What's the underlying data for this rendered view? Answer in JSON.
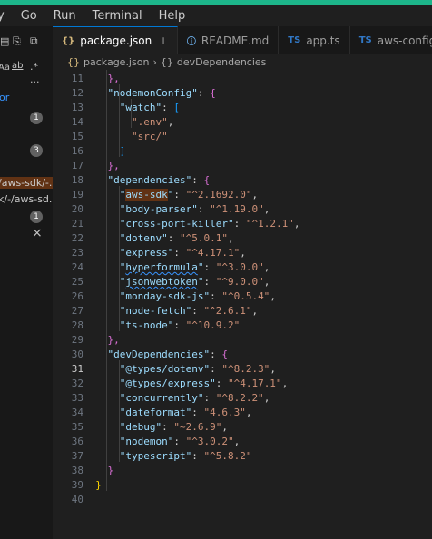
{
  "menu": {
    "items": [
      "Go",
      "Run",
      "Terminal",
      "Help"
    ],
    "partial_first": "y"
  },
  "sidebar": {
    "search_opts": [
      "Aa",
      "ab",
      ".*"
    ],
    "more": "···",
    "label_or": "or",
    "badges": [
      "1",
      "3",
      "1"
    ],
    "files": [
      "/aws-sdk/-...",
      "k/-/aws-sd..."
    ],
    "close": "×"
  },
  "tabs": [
    {
      "icon": "{}",
      "label": "package.json",
      "pinned": true,
      "active": true
    },
    {
      "icon": "ⓘ",
      "label": "README.md"
    },
    {
      "icon": "TS",
      "label": "app.ts"
    },
    {
      "icon": "TS",
      "label": "aws-config.ts"
    }
  ],
  "breadcrumb": {
    "file": "package.json",
    "symbol": "devDependencies"
  },
  "editor": {
    "current_line": 31,
    "lines": [
      {
        "n": "11",
        "t": [
          [
            "b2",
            "    },"
          ]
        ]
      },
      {
        "n": "12",
        "t": [
          [
            "k",
            "    \"nodemonConfig\""
          ],
          [
            "p",
            ": "
          ],
          [
            "b2",
            "{"
          ]
        ]
      },
      {
        "n": "13",
        "t": [
          [
            "k",
            "      \"watch\""
          ],
          [
            "p",
            ": "
          ],
          [
            "b3",
            "["
          ]
        ]
      },
      {
        "n": "14",
        "t": [
          [
            "s",
            "        \".env\""
          ],
          [
            "p",
            ","
          ]
        ]
      },
      {
        "n": "15",
        "t": [
          [
            "s",
            "        \"src/\""
          ]
        ]
      },
      {
        "n": "16",
        "t": [
          [
            "b3",
            "      ]"
          ]
        ]
      },
      {
        "n": "17",
        "t": [
          [
            "b2",
            "    },"
          ]
        ]
      },
      {
        "n": "18",
        "t": [
          [
            "k",
            "    \"dependencies\""
          ],
          [
            "p",
            ": "
          ],
          [
            "b2",
            "{"
          ]
        ]
      },
      {
        "n": "19",
        "t": [
          [
            "k",
            "      \""
          ],
          [
            "khl",
            "aws-sdk"
          ],
          [
            "k",
            "\""
          ],
          [
            "p",
            ": "
          ],
          [
            "s",
            "\"^2.1692.0\""
          ],
          [
            "p",
            ","
          ]
        ]
      },
      {
        "n": "20",
        "t": [
          [
            "k",
            "      \"body-parser\""
          ],
          [
            "p",
            ": "
          ],
          [
            "s",
            "\"^1.19.0\""
          ],
          [
            "p",
            ","
          ]
        ]
      },
      {
        "n": "21",
        "t": [
          [
            "k",
            "      \"cross-port-killer\""
          ],
          [
            "p",
            ": "
          ],
          [
            "s",
            "\"^1.2.1\""
          ],
          [
            "p",
            ","
          ]
        ]
      },
      {
        "n": "22",
        "t": [
          [
            "k",
            "      \"dotenv\""
          ],
          [
            "p",
            ": "
          ],
          [
            "s",
            "\"^5.0.1\""
          ],
          [
            "p",
            ","
          ]
        ]
      },
      {
        "n": "23",
        "t": [
          [
            "k",
            "      \"express\""
          ],
          [
            "p",
            ": "
          ],
          [
            "s",
            "\"^4.17.1\""
          ],
          [
            "p",
            ","
          ]
        ]
      },
      {
        "n": "24",
        "t": [
          [
            "k",
            "      \""
          ],
          [
            "ksq",
            "hyperformula"
          ],
          [
            "k",
            "\""
          ],
          [
            "p",
            ": "
          ],
          [
            "s",
            "\"^3.0.0\""
          ],
          [
            "p",
            ","
          ]
        ]
      },
      {
        "n": "25",
        "t": [
          [
            "k",
            "      \""
          ],
          [
            "ksq",
            "jsonwebtoken"
          ],
          [
            "k",
            "\""
          ],
          [
            "p",
            ": "
          ],
          [
            "s",
            "\"^9.0.0\""
          ],
          [
            "p",
            ","
          ]
        ]
      },
      {
        "n": "26",
        "t": [
          [
            "k",
            "      \"monday-sdk-js\""
          ],
          [
            "p",
            ": "
          ],
          [
            "s",
            "\"^0.5.4\""
          ],
          [
            "p",
            ","
          ]
        ]
      },
      {
        "n": "27",
        "t": [
          [
            "k",
            "      \"node-fetch\""
          ],
          [
            "p",
            ": "
          ],
          [
            "s",
            "\"^2.6.1\""
          ],
          [
            "p",
            ","
          ]
        ]
      },
      {
        "n": "28",
        "t": [
          [
            "k",
            "      \"ts-node\""
          ],
          [
            "p",
            ": "
          ],
          [
            "s",
            "\"^10.9.2\""
          ]
        ]
      },
      {
        "n": "29",
        "t": [
          [
            "b2",
            "    },"
          ]
        ]
      },
      {
        "n": "30",
        "t": [
          [
            "k",
            "    \"devDependencies\""
          ],
          [
            "p",
            ": "
          ],
          [
            "b2",
            "{"
          ]
        ]
      },
      {
        "n": "31",
        "t": [
          [
            "k",
            "      \"@types/dotenv\""
          ],
          [
            "p",
            ": "
          ],
          [
            "s",
            "\"^8.2.3\""
          ],
          [
            "p",
            ","
          ]
        ]
      },
      {
        "n": "32",
        "t": [
          [
            "k",
            "      \"@types/express\""
          ],
          [
            "p",
            ": "
          ],
          [
            "s",
            "\"^4.17.1\""
          ],
          [
            "p",
            ","
          ]
        ]
      },
      {
        "n": "33",
        "t": [
          [
            "k",
            "      \"concurrently\""
          ],
          [
            "p",
            ": "
          ],
          [
            "s",
            "\"^8.2.2\""
          ],
          [
            "p",
            ","
          ]
        ]
      },
      {
        "n": "34",
        "t": [
          [
            "k",
            "      \"dateformat\""
          ],
          [
            "p",
            ": "
          ],
          [
            "s",
            "\"4.6.3\""
          ],
          [
            "p",
            ","
          ]
        ]
      },
      {
        "n": "35",
        "t": [
          [
            "k",
            "      \"debug\""
          ],
          [
            "p",
            ": "
          ],
          [
            "s",
            "\"~2.6.9\""
          ],
          [
            "p",
            ","
          ]
        ]
      },
      {
        "n": "36",
        "t": [
          [
            "k",
            "      \"nodemon\""
          ],
          [
            "p",
            ": "
          ],
          [
            "s",
            "\"^3.0.2\""
          ],
          [
            "p",
            ","
          ]
        ]
      },
      {
        "n": "37",
        "t": [
          [
            "k",
            "      \"typescript\""
          ],
          [
            "p",
            ": "
          ],
          [
            "s",
            "\"^5.8.2\""
          ]
        ]
      },
      {
        "n": "38",
        "t": [
          [
            "b2",
            "    }"
          ]
        ]
      },
      {
        "n": "39",
        "t": [
          [
            "b1",
            "  }"
          ]
        ]
      },
      {
        "n": "40",
        "t": []
      }
    ]
  },
  "colors": {
    "accent": "#1db58a",
    "active_tab_border": "#0078d4",
    "key": "#9cdcfe",
    "string": "#ce9178"
  }
}
